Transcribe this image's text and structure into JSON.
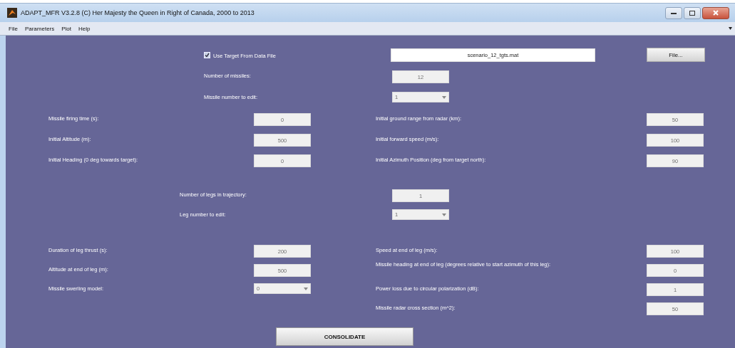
{
  "window": {
    "title": "ADAPT_MFR  V3.2.8  (C) Her Majesty the Queen in Right of Canada, 2000 to 2013"
  },
  "menu": [
    "File",
    "Parameters",
    "Plot",
    "Help"
  ],
  "target_file": {
    "label": "Use Target From Data File",
    "checked": true,
    "value": "scenario_12_tgts.mat",
    "button": "File..."
  },
  "missile_count": {
    "label": "Number of missiles:",
    "value": "12",
    "kind": "field"
  },
  "missile_select": {
    "label": "Missile number to edit:",
    "value": "1",
    "kind": "dropdown"
  },
  "missile_params": {
    "left": [
      {
        "label": "Missile firing time (s):",
        "value": "0",
        "kind": "field"
      },
      {
        "label": "Initial Altitude (m):",
        "value": "500",
        "kind": "field"
      },
      {
        "label": "Initial Heading (0 deg towards target):",
        "value": "0",
        "kind": "field"
      }
    ],
    "right": [
      {
        "label": "Initial ground range from radar (km):",
        "value": "50",
        "kind": "field"
      },
      {
        "label": "Initial forward speed (m/s):",
        "value": "100",
        "kind": "field"
      },
      {
        "label": "Initial Azimuth Position (deg from target north):",
        "value": "90",
        "kind": "field"
      }
    ]
  },
  "leg_count": {
    "label": "Number of legs in trajectory:",
    "value": "1",
    "kind": "field"
  },
  "leg_select": {
    "label": "Leg number to edit:",
    "value": "1",
    "kind": "dropdown"
  },
  "leg_params": {
    "left": [
      {
        "label": "Duration of leg thrust (s):",
        "value": "200",
        "kind": "field"
      },
      {
        "label": "Altitude at end of leg (m):",
        "value": "500",
        "kind": "field"
      },
      {
        "label": "Missile swerling model:",
        "value": "0",
        "kind": "dropdown"
      }
    ],
    "right": [
      {
        "label": "Speed at end of leg (m/s):",
        "value": "100",
        "kind": "field"
      },
      {
        "label": "Missile heading at end of leg (degrees relative to start azimuth of this leg):",
        "value": "0",
        "kind": "field"
      },
      {
        "label": "Power loss due to circular polarization (dB):",
        "value": "1",
        "kind": "field"
      },
      {
        "label": "Missile radar cross section (m^2):",
        "value": "50",
        "kind": "field"
      }
    ]
  },
  "consolidate_button": "CONSOLIDATE"
}
